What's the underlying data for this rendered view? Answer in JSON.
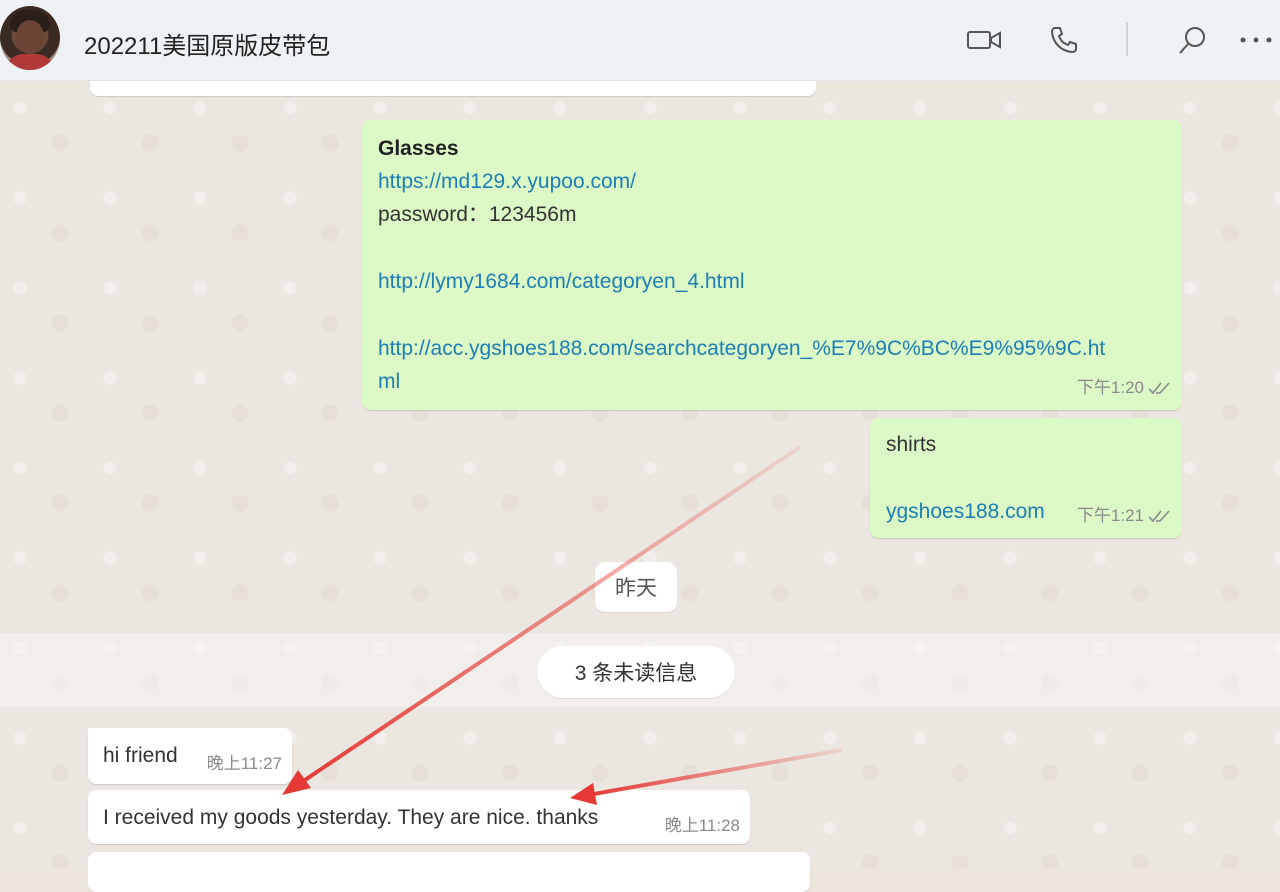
{
  "header": {
    "title": "202211美国原版皮带包",
    "icons": [
      "video-call-icon",
      "voice-call-icon",
      "search-icon",
      "more-icon"
    ]
  },
  "messages": {
    "glasses": {
      "heading": "Glasses",
      "link1": "https://md129.x.yupoo.com/",
      "password": "password：123456m",
      "link2": "http://lymy1684.com/categoryen_4.html",
      "link3_line1": "http://acc.ygshoes188.com/searchcategoryen_%E7%9C%BC%E9%95%9C.ht",
      "link3_line2": "ml",
      "time": "下午1:20"
    },
    "shirts": {
      "text": "shirts",
      "link": "ygshoes188.com",
      "time": "下午1:21"
    },
    "date_divider": "昨天",
    "unread": "3 条未读信息",
    "hi": {
      "text": "hi friend",
      "time": "晚上11:27"
    },
    "received": {
      "text": "I received my goods yesterday. They are nice. thanks",
      "time": "晚上11:28"
    }
  },
  "colors": {
    "outgoing_bubble": "#dcf8c6",
    "incoming_bubble": "#ffffff",
    "link": "#1d7fb3",
    "annotation_arrow": "#e53935"
  }
}
